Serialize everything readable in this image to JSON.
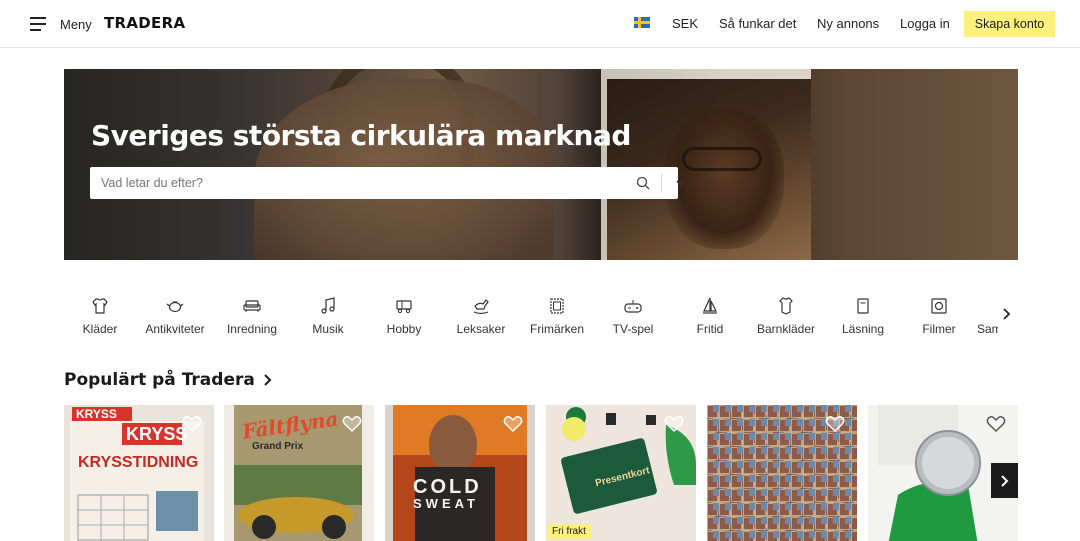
{
  "header": {
    "menu_label": "Meny",
    "logo": "TRADERA",
    "currency": "SEK",
    "how_it_works": "Så funkar det",
    "new_listing": "Ny annons",
    "login": "Logga in",
    "create_account": "Skapa konto"
  },
  "hero": {
    "title": "Sveriges största cirkulära marknad",
    "search_placeholder": "Vad letar du efter?"
  },
  "categories": [
    {
      "label": "Kläder",
      "icon": "tshirt-icon"
    },
    {
      "label": "Antikviteter",
      "icon": "teapot-icon"
    },
    {
      "label": "Inredning",
      "icon": "sofa-icon"
    },
    {
      "label": "Musik",
      "icon": "music-note-icon"
    },
    {
      "label": "Hobby",
      "icon": "train-icon"
    },
    {
      "label": "Leksaker",
      "icon": "rocking-horse-icon"
    },
    {
      "label": "Frimärken",
      "icon": "stamp-icon"
    },
    {
      "label": "TV-spel",
      "icon": "game-controller-icon"
    },
    {
      "label": "Fritid",
      "icon": "sailboat-icon"
    },
    {
      "label": "Barnkläder",
      "icon": "baby-clothes-icon"
    },
    {
      "label": "Läsning",
      "icon": "book-icon"
    },
    {
      "label": "Filmer",
      "icon": "film-icon"
    },
    {
      "label": "Samlarsaker",
      "icon": "collectible-icon"
    }
  ],
  "popular": {
    "title": "Populärt på Tradera",
    "items": [
      {
        "image_text": "KRYSS KRYSSTIDNING",
        "badge": ""
      },
      {
        "image_text": "Fältflyna Grand Prix",
        "badge": ""
      },
      {
        "image_text": "COLD SWEAT",
        "badge": ""
      },
      {
        "image_text": "Presentkort",
        "badge": "Fri frakt"
      },
      {
        "image_text": "",
        "badge": ""
      },
      {
        "image_text": "",
        "badge": ""
      }
    ]
  }
}
